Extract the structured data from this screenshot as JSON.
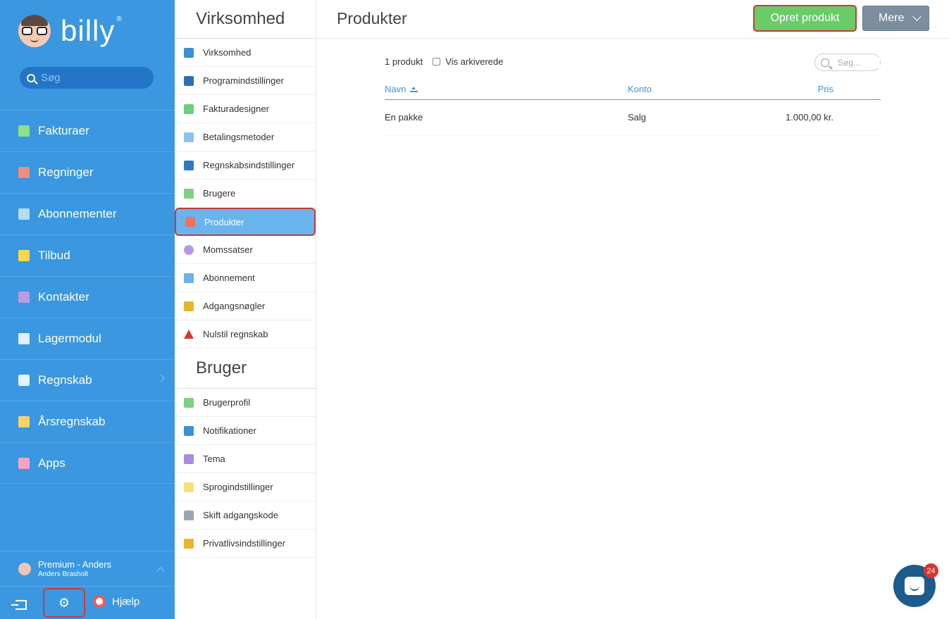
{
  "brand": {
    "name": "billy",
    "reg": "®"
  },
  "sidebar": {
    "search_placeholder": "Søg",
    "items": [
      {
        "label": "Fakturaer",
        "icon": "invoice-icon",
        "color": "#8ee08a"
      },
      {
        "label": "Regninger",
        "icon": "bill-icon",
        "color": "#f28b80"
      },
      {
        "label": "Abonnementer",
        "icon": "subscription-icon",
        "color": "#b8dcf7"
      },
      {
        "label": "Tilbud",
        "icon": "star-icon",
        "color": "#f7d84a"
      },
      {
        "label": "Kontakter",
        "icon": "contact-icon",
        "color": "#b89be0"
      },
      {
        "label": "Lagermodul",
        "icon": "inventory-icon",
        "color": "#dfefff"
      },
      {
        "label": "Regnskab",
        "icon": "accounting-icon",
        "color": "#e6f3ff"
      },
      {
        "label": "Årsregnskab",
        "icon": "annual-report-icon",
        "color": "#f3d46a"
      },
      {
        "label": "Apps",
        "icon": "apps-icon",
        "color": "#f4a3c0"
      }
    ],
    "user": {
      "org": "Premium - Anders",
      "name": "Anders Brasholt"
    },
    "help_label": "Hjælp"
  },
  "subnav": {
    "company_heading": "Virksomhed",
    "company_items": [
      {
        "label": "Virksomhed",
        "icon": "company-icon",
        "color": "#3a8fd6"
      },
      {
        "label": "Programindstillinger",
        "icon": "gear-icon",
        "color": "#2e6fb0"
      },
      {
        "label": "Fakturadesigner",
        "icon": "invoice-designer-icon",
        "color": "#6ccf7a"
      },
      {
        "label": "Betalingsmetoder",
        "icon": "payment-method-icon",
        "color": "#8cc2ee"
      },
      {
        "label": "Regnskabsindstillinger",
        "icon": "accounting-settings-icon",
        "color": "#2f78c4"
      },
      {
        "label": "Brugere",
        "icon": "users-icon",
        "color": "#7fd07f"
      },
      {
        "label": "Produkter",
        "icon": "products-icon",
        "color": "#f07060",
        "active": true
      },
      {
        "label": "Momssatser",
        "icon": "vat-icon",
        "color": "#b898e6"
      },
      {
        "label": "Abonnement",
        "icon": "subscription-plan-icon",
        "color": "#6cb0ea"
      },
      {
        "label": "Adgangsnøgler",
        "icon": "key-icon",
        "color": "#e9b530"
      },
      {
        "label": "Nulstil regnskab",
        "icon": "warning-icon",
        "color": "#d23a2e"
      }
    ],
    "user_heading": "Bruger",
    "user_items": [
      {
        "label": "Brugerprofil",
        "icon": "user-profile-icon",
        "color": "#7fd07f"
      },
      {
        "label": "Notifikationer",
        "icon": "notifications-icon",
        "color": "#3a8fd6"
      },
      {
        "label": "Tema",
        "icon": "theme-icon",
        "color": "#a88be0"
      },
      {
        "label": "Sprogindstillinger",
        "icon": "language-icon",
        "color": "#f7e07a"
      },
      {
        "label": "Skift adgangskode",
        "icon": "lock-icon",
        "color": "#9aa6b2"
      },
      {
        "label": "Privatlivsindstillinger",
        "icon": "privacy-key-icon",
        "color": "#e9b530"
      }
    ]
  },
  "main": {
    "title": "Produkter",
    "create_label": "Opret produkt",
    "more_label": "Mere",
    "count_label": "1 produkt",
    "archived_label": "Vis arkiverede",
    "search_placeholder": "Søg...",
    "columns": {
      "name": "Navn",
      "account": "Konto",
      "price": "Pris"
    },
    "rows": [
      {
        "name": "En pakke",
        "account": "Salg",
        "price": "1.000,00 kr."
      }
    ]
  },
  "chat": {
    "badge": "24"
  }
}
